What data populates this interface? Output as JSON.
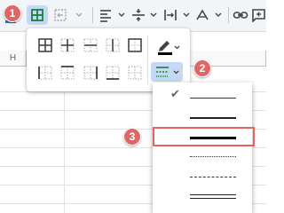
{
  "column_header": {
    "label": "H"
  },
  "steps": {
    "one": "1",
    "two": "2",
    "three": "3"
  },
  "colors": {
    "badge": "#e06666",
    "accent_green": "#188038",
    "selected_highlight": "#c5d9f7"
  },
  "toolbar_icons": [
    "text-color-icon",
    "borders-icon",
    "merge-cells-icon",
    "horizontal-align-icon",
    "vertical-align-icon",
    "text-wrap-icon",
    "text-rotation-icon",
    "insert-link-icon",
    "insert-comment-icon"
  ],
  "border_options": [
    "all-borders-icon",
    "inner-borders-icon",
    "horizontal-borders-icon",
    "vertical-borders-icon",
    "outer-borders-icon",
    "left-border-icon",
    "top-border-icon",
    "right-border-icon",
    "bottom-border-icon",
    "clear-borders-icon"
  ],
  "line_styles": [
    {
      "name": "thin-solid",
      "selected": true
    },
    {
      "name": "medium-solid",
      "selected": false
    },
    {
      "name": "thick-solid",
      "selected": false
    },
    {
      "name": "dotted",
      "selected": false
    },
    {
      "name": "dashed",
      "selected": false
    },
    {
      "name": "double",
      "selected": false
    }
  ],
  "check_mark": "✔"
}
